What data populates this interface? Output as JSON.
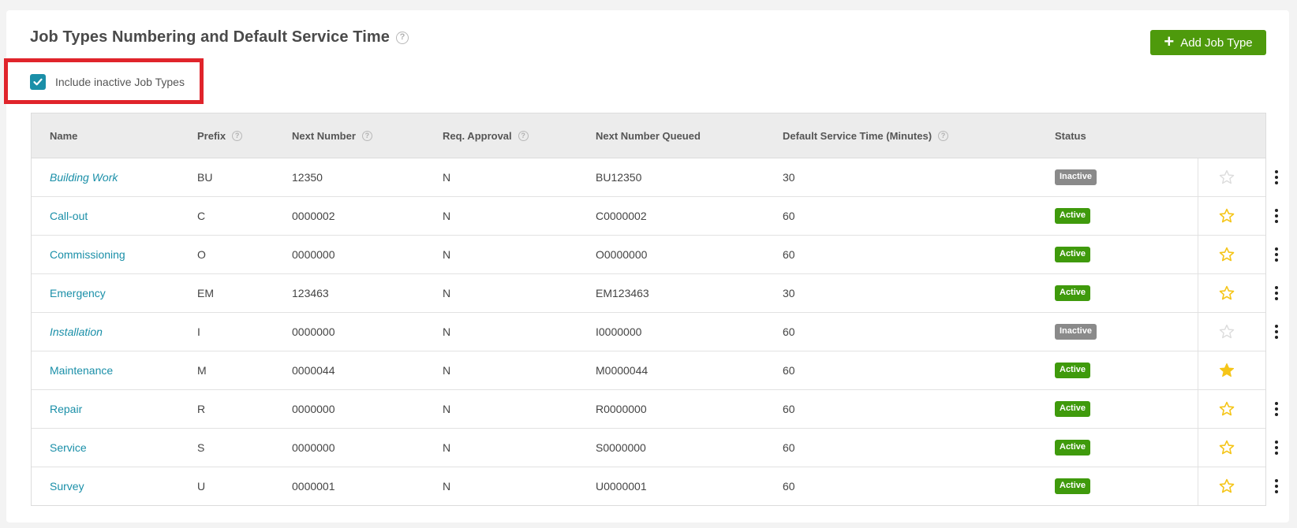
{
  "header": {
    "title": "Job Types Numbering and Default Service Time",
    "help_icon": "question-circle-icon",
    "add_button_label": "Add Job Type"
  },
  "filter": {
    "include_inactive_label": "Include inactive Job Types",
    "include_inactive_checked": true
  },
  "colors": {
    "accent": "#1a8fa8",
    "primary_button": "#4e9a0c",
    "active_badge": "#3f9a0c",
    "inactive_badge": "#8a8a8a",
    "highlight": "#e0242b",
    "star_active": "#f5c518"
  },
  "table": {
    "columns": [
      "Name",
      "Prefix",
      "Next Number",
      "Req. Approval",
      "Next Number Queued",
      "Default Service Time (Minutes)",
      "Status"
    ],
    "rows": [
      {
        "name": "Building Work",
        "prefix": "BU",
        "next_number": "12350",
        "req_approval": "N",
        "queued": "BU12350",
        "service_time": "30",
        "status": "Inactive",
        "star": "empty-light",
        "menu": true
      },
      {
        "name": "Call-out",
        "prefix": "C",
        "next_number": "0000002",
        "req_approval": "N",
        "queued": "C0000002",
        "service_time": "60",
        "status": "Active",
        "star": "outline",
        "menu": true
      },
      {
        "name": "Commissioning",
        "prefix": "O",
        "next_number": "0000000",
        "req_approval": "N",
        "queued": "O0000000",
        "service_time": "60",
        "status": "Active",
        "star": "outline",
        "menu": true
      },
      {
        "name": "Emergency",
        "prefix": "EM",
        "next_number": "123463",
        "req_approval": "N",
        "queued": "EM123463",
        "service_time": "30",
        "status": "Active",
        "star": "outline",
        "menu": true
      },
      {
        "name": "Installation",
        "prefix": "I",
        "next_number": "0000000",
        "req_approval": "N",
        "queued": "I0000000",
        "service_time": "60",
        "status": "Inactive",
        "star": "empty-light",
        "menu": true
      },
      {
        "name": "Maintenance",
        "prefix": "M",
        "next_number": "0000044",
        "req_approval": "N",
        "queued": "M0000044",
        "service_time": "60",
        "status": "Active",
        "star": "filled",
        "menu": false
      },
      {
        "name": "Repair",
        "prefix": "R",
        "next_number": "0000000",
        "req_approval": "N",
        "queued": "R0000000",
        "service_time": "60",
        "status": "Active",
        "star": "outline",
        "menu": true
      },
      {
        "name": "Service",
        "prefix": "S",
        "next_number": "0000000",
        "req_approval": "N",
        "queued": "S0000000",
        "service_time": "60",
        "status": "Active",
        "star": "outline",
        "menu": true
      },
      {
        "name": "Survey",
        "prefix": "U",
        "next_number": "0000001",
        "req_approval": "N",
        "queued": "U0000001",
        "service_time": "60",
        "status": "Active",
        "star": "outline",
        "menu": true
      }
    ]
  }
}
